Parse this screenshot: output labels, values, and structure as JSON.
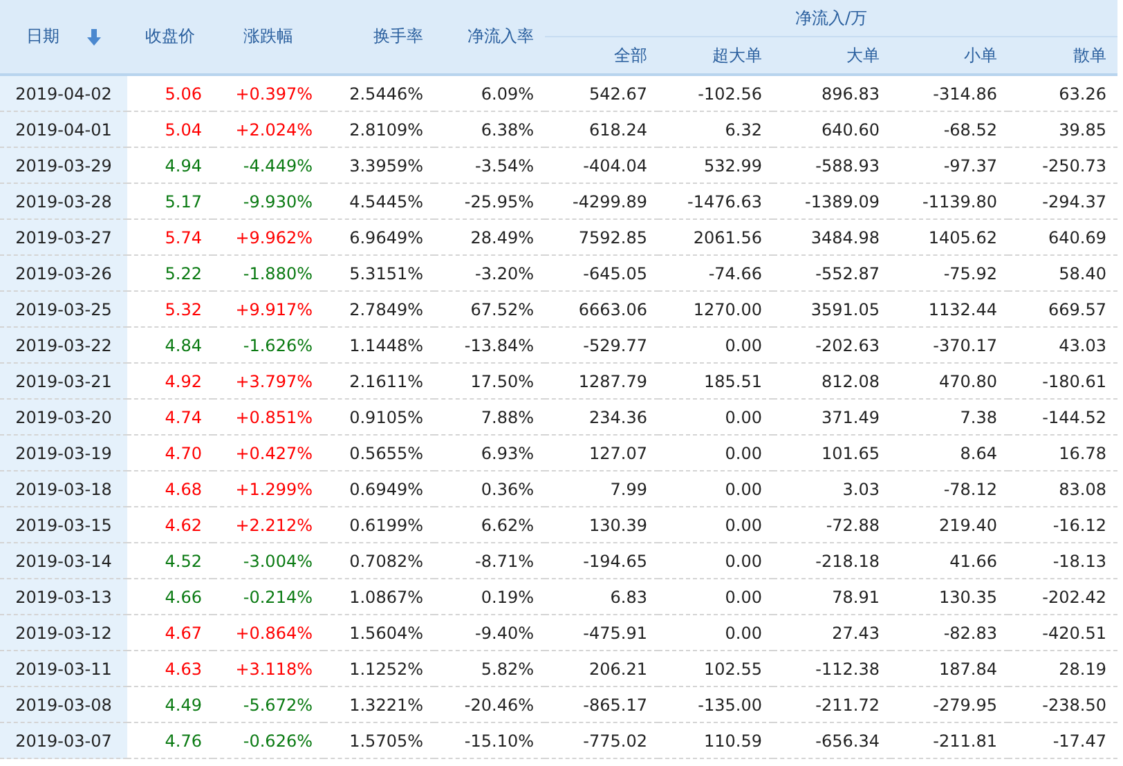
{
  "table": {
    "columns": [
      {
        "label": "日期",
        "sorted": true
      },
      {
        "label": "收盘价",
        "sorted": false
      },
      {
        "label": "涨跌幅",
        "sorted": false
      },
      {
        "label": "换手率",
        "sorted": false
      },
      {
        "label": "净流入率",
        "sorted": false
      }
    ],
    "group": {
      "label": "净流入/万",
      "columns": [
        "全部",
        "超大单",
        "大单",
        "小单",
        "散单"
      ]
    },
    "rows": [
      {
        "date": "2019-04-02",
        "rising": true,
        "close": "5.06",
        "change": "+0.397%",
        "turnover": "2.5446%",
        "ratio": "6.09%",
        "flows": [
          "542.67",
          "-102.56",
          "896.83",
          "-314.86",
          "63.26"
        ]
      },
      {
        "date": "2019-04-01",
        "rising": true,
        "close": "5.04",
        "change": "+2.024%",
        "turnover": "2.8109%",
        "ratio": "6.38%",
        "flows": [
          "618.24",
          "6.32",
          "640.60",
          "-68.52",
          "39.85"
        ]
      },
      {
        "date": "2019-03-29",
        "rising": false,
        "close": "4.94",
        "change": "-4.449%",
        "turnover": "3.3959%",
        "ratio": "-3.54%",
        "flows": [
          "-404.04",
          "532.99",
          "-588.93",
          "-97.37",
          "-250.73"
        ]
      },
      {
        "date": "2019-03-28",
        "rising": false,
        "close": "5.17",
        "change": "-9.930%",
        "turnover": "4.5445%",
        "ratio": "-25.95%",
        "flows": [
          "-4299.89",
          "-1476.63",
          "-1389.09",
          "-1139.80",
          "-294.37"
        ]
      },
      {
        "date": "2019-03-27",
        "rising": true,
        "close": "5.74",
        "change": "+9.962%",
        "turnover": "6.9649%",
        "ratio": "28.49%",
        "flows": [
          "7592.85",
          "2061.56",
          "3484.98",
          "1405.62",
          "640.69"
        ]
      },
      {
        "date": "2019-03-26",
        "rising": false,
        "close": "5.22",
        "change": "-1.880%",
        "turnover": "5.3151%",
        "ratio": "-3.20%",
        "flows": [
          "-645.05",
          "-74.66",
          "-552.87",
          "-75.92",
          "58.40"
        ]
      },
      {
        "date": "2019-03-25",
        "rising": true,
        "close": "5.32",
        "change": "+9.917%",
        "turnover": "2.7849%",
        "ratio": "67.52%",
        "flows": [
          "6663.06",
          "1270.00",
          "3591.05",
          "1132.44",
          "669.57"
        ]
      },
      {
        "date": "2019-03-22",
        "rising": false,
        "close": "4.84",
        "change": "-1.626%",
        "turnover": "1.1448%",
        "ratio": "-13.84%",
        "flows": [
          "-529.77",
          "0.00",
          "-202.63",
          "-370.17",
          "43.03"
        ]
      },
      {
        "date": "2019-03-21",
        "rising": true,
        "close": "4.92",
        "change": "+3.797%",
        "turnover": "2.1611%",
        "ratio": "17.50%",
        "flows": [
          "1287.79",
          "185.51",
          "812.08",
          "470.80",
          "-180.61"
        ]
      },
      {
        "date": "2019-03-20",
        "rising": true,
        "close": "4.74",
        "change": "+0.851%",
        "turnover": "0.9105%",
        "ratio": "7.88%",
        "flows": [
          "234.36",
          "0.00",
          "371.49",
          "7.38",
          "-144.52"
        ]
      },
      {
        "date": "2019-03-19",
        "rising": true,
        "close": "4.70",
        "change": "+0.427%",
        "turnover": "0.5655%",
        "ratio": "6.93%",
        "flows": [
          "127.07",
          "0.00",
          "101.65",
          "8.64",
          "16.78"
        ]
      },
      {
        "date": "2019-03-18",
        "rising": true,
        "close": "4.68",
        "change": "+1.299%",
        "turnover": "0.6949%",
        "ratio": "0.36%",
        "flows": [
          "7.99",
          "0.00",
          "3.03",
          "-78.12",
          "83.08"
        ]
      },
      {
        "date": "2019-03-15",
        "rising": true,
        "close": "4.62",
        "change": "+2.212%",
        "turnover": "0.6199%",
        "ratio": "6.62%",
        "flows": [
          "130.39",
          "0.00",
          "-72.88",
          "219.40",
          "-16.12"
        ]
      },
      {
        "date": "2019-03-14",
        "rising": false,
        "close": "4.52",
        "change": "-3.004%",
        "turnover": "0.7082%",
        "ratio": "-8.71%",
        "flows": [
          "-194.65",
          "0.00",
          "-218.18",
          "41.66",
          "-18.13"
        ]
      },
      {
        "date": "2019-03-13",
        "rising": false,
        "close": "4.66",
        "change": "-0.214%",
        "turnover": "1.0867%",
        "ratio": "0.19%",
        "flows": [
          "6.83",
          "0.00",
          "78.91",
          "130.35",
          "-202.42"
        ]
      },
      {
        "date": "2019-03-12",
        "rising": true,
        "close": "4.67",
        "change": "+0.864%",
        "turnover": "1.5604%",
        "ratio": "-9.40%",
        "flows": [
          "-475.91",
          "0.00",
          "27.43",
          "-82.83",
          "-420.51"
        ]
      },
      {
        "date": "2019-03-11",
        "rising": true,
        "close": "4.63",
        "change": "+3.118%",
        "turnover": "1.1252%",
        "ratio": "5.82%",
        "flows": [
          "206.21",
          "102.55",
          "-112.38",
          "187.84",
          "28.19"
        ]
      },
      {
        "date": "2019-03-08",
        "rising": false,
        "close": "4.49",
        "change": "-5.672%",
        "turnover": "1.3221%",
        "ratio": "-20.46%",
        "flows": [
          "-865.17",
          "-135.00",
          "-211.72",
          "-279.95",
          "-238.50"
        ]
      },
      {
        "date": "2019-03-07",
        "rising": false,
        "close": "4.76",
        "change": "-0.626%",
        "turnover": "1.5705%",
        "ratio": "-15.10%",
        "flows": [
          "-775.02",
          "110.59",
          "-656.34",
          "-211.81",
          "-17.47"
        ]
      }
    ]
  }
}
